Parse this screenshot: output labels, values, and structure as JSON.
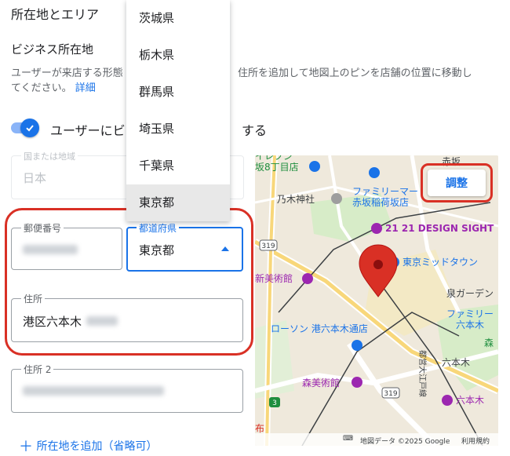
{
  "section": {
    "title": "所在地とエリア",
    "business_title": "ビジネス所在地",
    "description_line1_a": "ユーザーが来店する形態",
    "description_line1_b": "住所を追加して地図上のピンを店舗の位置に移動し",
    "description_line2": "てください。",
    "details_link": "詳細"
  },
  "toggle": {
    "label_a": "ユーザーにビ",
    "label_b": "する",
    "checked": true
  },
  "country": {
    "label": "国または地域",
    "value": "日本"
  },
  "postal": {
    "label": "郵便番号"
  },
  "prefecture": {
    "label": "都道府県",
    "value": "東京都"
  },
  "address": {
    "label": "住所",
    "value": "港区六本木"
  },
  "address2": {
    "label": "住所 2"
  },
  "add_area": {
    "label": "所在地を追加（省略可）"
  },
  "dropdown": {
    "options": [
      "茨城県",
      "栃木県",
      "群馬県",
      "埼玉県",
      "千葉県",
      "東京都"
    ],
    "selected": "東京都"
  },
  "map": {
    "adjust_label": "調整",
    "labels": {
      "seven": "イレブン",
      "seven2": "坂8丁目店",
      "akasaka": "赤坂",
      "familymart1": "ファミリーマー",
      "familymart1b": "赤坂稲荷坂店",
      "nogi": "乃木神社",
      "design": "21 21 DESIGN SIGHT",
      "midtown": "東京ミッドタウン",
      "museum": "新美術館",
      "garden": "泉ガーデン",
      "familymart2": "ファミリー",
      "familymart2b": "六本木",
      "lawson": "ローソン 港六本木通店",
      "mori": "森",
      "roppongi": "六本木",
      "mori_museum": "森美術館",
      "toei": "都営大江戸線",
      "roppongi2": "六本木",
      "road319a": "319",
      "road319b": "319",
      "road3": "3",
      "cloth": "布"
    },
    "footer": {
      "data": "地図データ ©2025 Google",
      "terms": "利用規約"
    },
    "colors": {
      "pin": "#d93025",
      "park": "#cfe8c0",
      "poi_purple": "#9c27b0",
      "poi_blue": "#1a73e8"
    }
  }
}
